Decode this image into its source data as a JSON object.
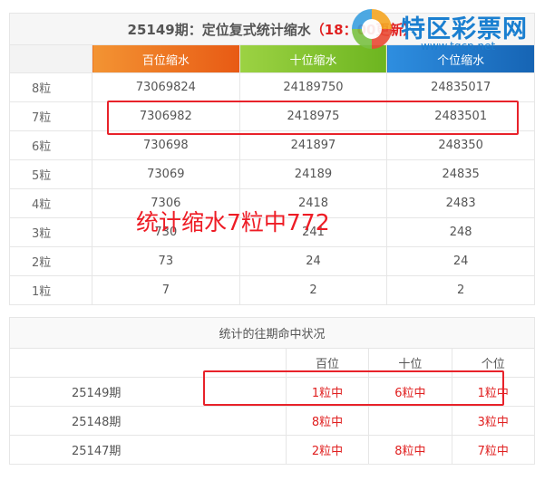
{
  "title": {
    "main": "25149期：定位复式统计缩水",
    "update": "（18：00更新）"
  },
  "columns": [
    "百位缩水",
    "十位缩水",
    "个位缩水"
  ],
  "rows": [
    {
      "label": "8粒",
      "values": [
        "73069824",
        "24189750",
        "24835017"
      ]
    },
    {
      "label": "7粒",
      "values": [
        "7306982",
        "2418975",
        "2483501"
      ]
    },
    {
      "label": "6粒",
      "values": [
        "730698",
        "241897",
        "248350"
      ]
    },
    {
      "label": "5粒",
      "values": [
        "73069",
        "24189",
        "24835"
      ]
    },
    {
      "label": "4粒",
      "values": [
        "7306",
        "2418",
        "2483"
      ]
    },
    {
      "label": "3粒",
      "values": [
        "730",
        "241",
        "248"
      ]
    },
    {
      "label": "2粒",
      "values": [
        "73",
        "24",
        "24"
      ]
    },
    {
      "label": "1粒",
      "values": [
        "7",
        "2",
        "2"
      ]
    }
  ],
  "overlay_text": "统计缩水7粒中772",
  "history": {
    "caption": "统计的往期命中状况",
    "headers": [
      "",
      "百位",
      "十位",
      "个位"
    ],
    "rows": [
      {
        "period": "25149期",
        "hits": [
          "1粒中",
          "6粒中",
          "1粒中"
        ]
      },
      {
        "period": "25148期",
        "hits": [
          "8粒中",
          "",
          "3粒中"
        ]
      },
      {
        "period": "25147期",
        "hits": [
          "2粒中",
          "8粒中",
          "7粒中"
        ]
      }
    ]
  },
  "logo": {
    "name": "特区彩票网",
    "url": "www.tqcp.net"
  },
  "colors": {
    "highlight": "#e8222a",
    "orange": "#f0752a",
    "green": "#7fc02f",
    "blue": "#1e7bd0"
  }
}
